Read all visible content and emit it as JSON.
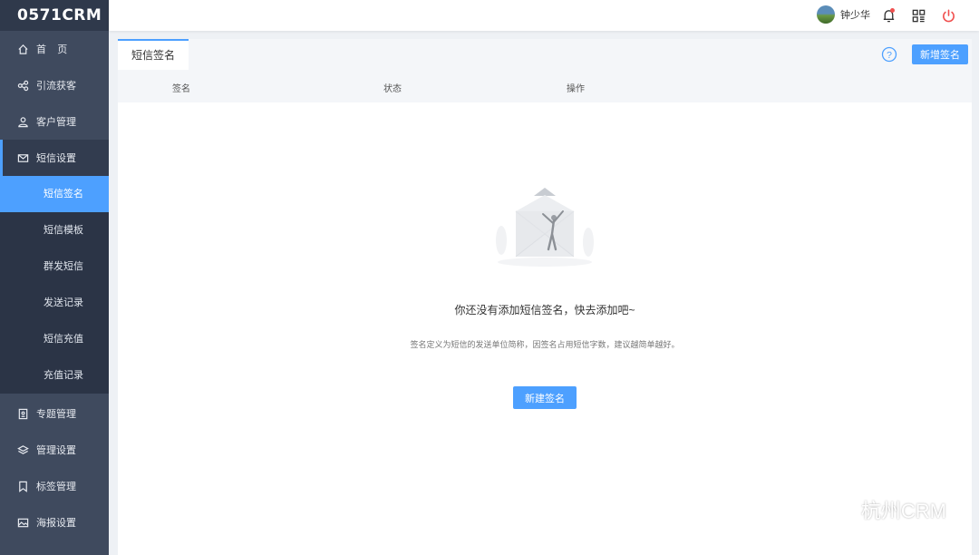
{
  "app": {
    "logo": "0571CRM"
  },
  "sidebar": {
    "items_top": [
      {
        "label": "首    页",
        "icon": "home-icon"
      },
      {
        "label": "引流获客",
        "icon": "share-icon"
      },
      {
        "label": "客户管理",
        "icon": "user-icon"
      },
      {
        "label": "短信设置",
        "icon": "mail-icon"
      }
    ],
    "submenu": [
      {
        "label": "短信签名"
      },
      {
        "label": "短信模板"
      },
      {
        "label": "群发短信"
      },
      {
        "label": "发送记录"
      },
      {
        "label": "短信充值"
      },
      {
        "label": "充值记录"
      }
    ],
    "items_bottom": [
      {
        "label": "专题管理",
        "icon": "topic-icon"
      },
      {
        "label": "管理设置",
        "icon": "layers-icon"
      },
      {
        "label": "标签管理",
        "icon": "tag-icon"
      },
      {
        "label": "海报设置",
        "icon": "image-icon"
      }
    ]
  },
  "header": {
    "username": "钟少华"
  },
  "tabs": [
    {
      "label": "短信签名"
    }
  ],
  "toolbar": {
    "add_label": "新增签名"
  },
  "table": {
    "columns": [
      "签名",
      "状态",
      "操作"
    ],
    "rows": []
  },
  "empty": {
    "title": "你还没有添加短信签名，快去添加吧~",
    "desc": "签名定义为短信的发送单位简称，因签名占用短信字数，建议越简单越好。",
    "button": "新建签名"
  },
  "watermark": {
    "text": "杭州CRM"
  },
  "colors": {
    "accent": "#4da0ff",
    "sidebar": "#3f4a5e",
    "submenu": "#2b3446",
    "danger": "#f0504f"
  }
}
